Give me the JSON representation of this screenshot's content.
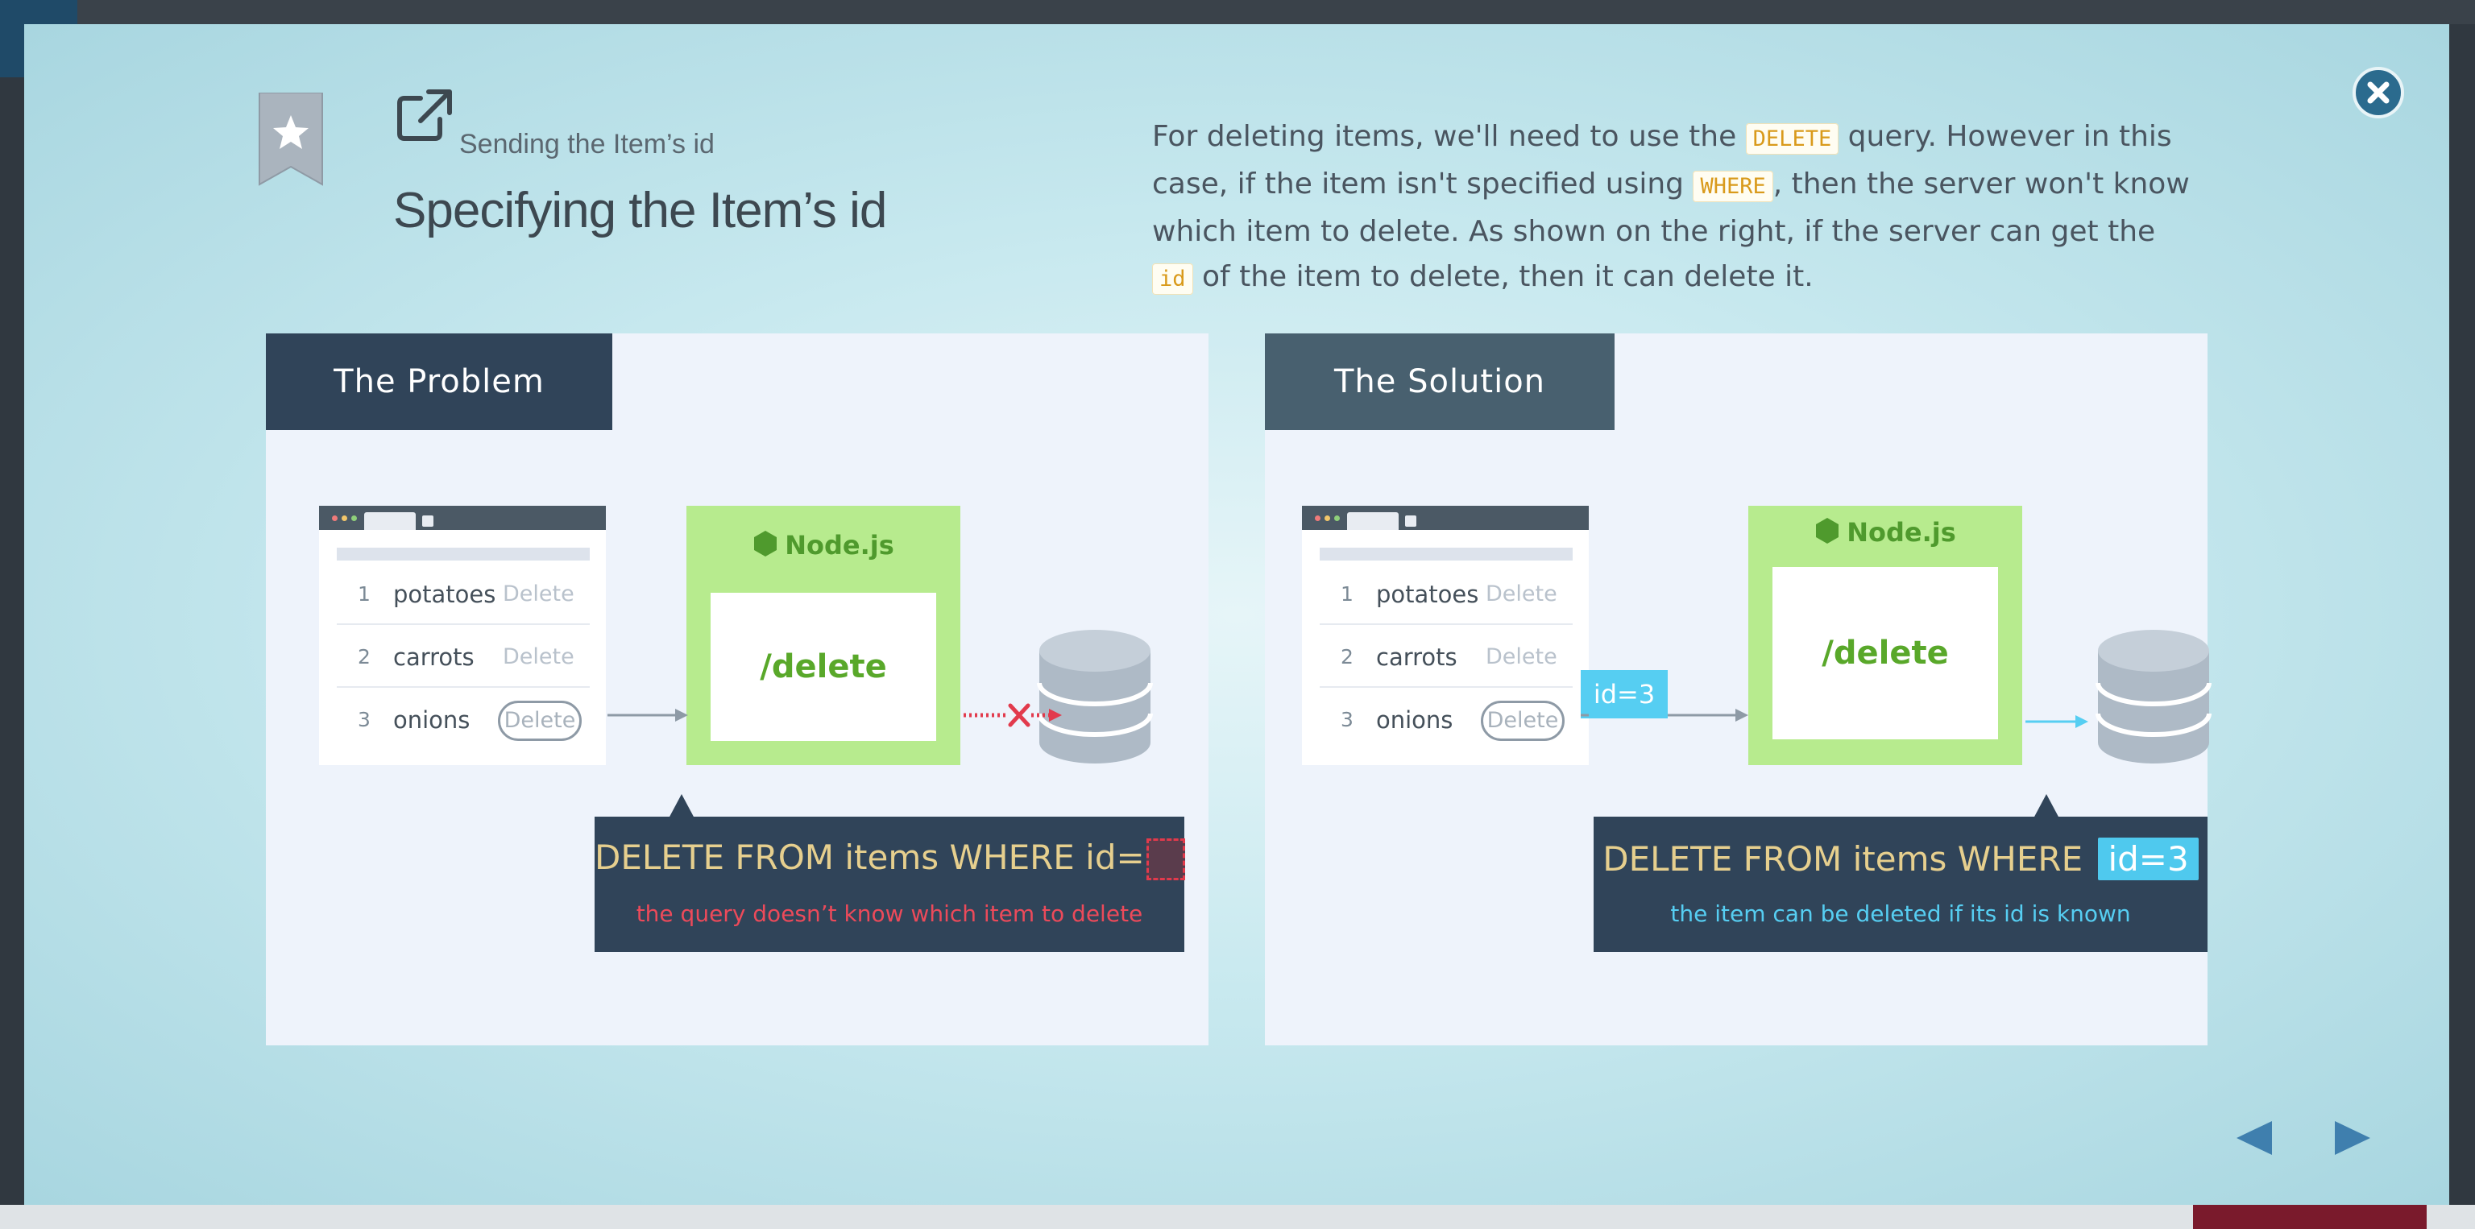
{
  "modal": {
    "subtitle": "Sending the Item’s id",
    "title": "Specifying the Item’s id",
    "description": {
      "p1": "For deleting items, we'll need to use the ",
      "code1": "DELETE",
      "p2": " query. However in this case, if the item isn't specified using ",
      "code2": "WHERE",
      "p3": ", then the server won't know which item to delete. As shown on the right, if the server can get the ",
      "code3": "id",
      "p4": " of the item to delete, then it can delete it."
    }
  },
  "colors": {
    "accent": "#2b6b8e",
    "problem_header": "#304459",
    "solution_header": "#48606f",
    "node_green": "#b7eb8e",
    "error_red": "#e23a4c",
    "id_blue": "#56cef2",
    "code_orange": "#d99a1b"
  },
  "icons": {
    "close": "close-icon",
    "bookmark": "bookmark-star-icon",
    "external": "external-link-icon",
    "prev": "prev-arrow-icon",
    "next": "next-arrow-icon",
    "database": "database-icon",
    "node": "nodejs-hexagon-icon"
  },
  "items": [
    {
      "num": "1",
      "name": "potatoes",
      "action": "Delete"
    },
    {
      "num": "2",
      "name": "carrots",
      "action": "Delete"
    },
    {
      "num": "3",
      "name": "onions",
      "action": "Delete"
    }
  ],
  "problem": {
    "header": "The Problem",
    "server_name": "Node.js",
    "route": "/delete",
    "query": "DELETE FROM items WHERE id=",
    "note": "the query doesn’t know which item to delete"
  },
  "solution": {
    "header": "The Solution",
    "server_name": "Node.js",
    "route": "/delete",
    "id_tag": "id=3",
    "query": "DELETE FROM items WHERE ",
    "query_id": "id=3",
    "note": "the item can be deleted if its id is known"
  }
}
